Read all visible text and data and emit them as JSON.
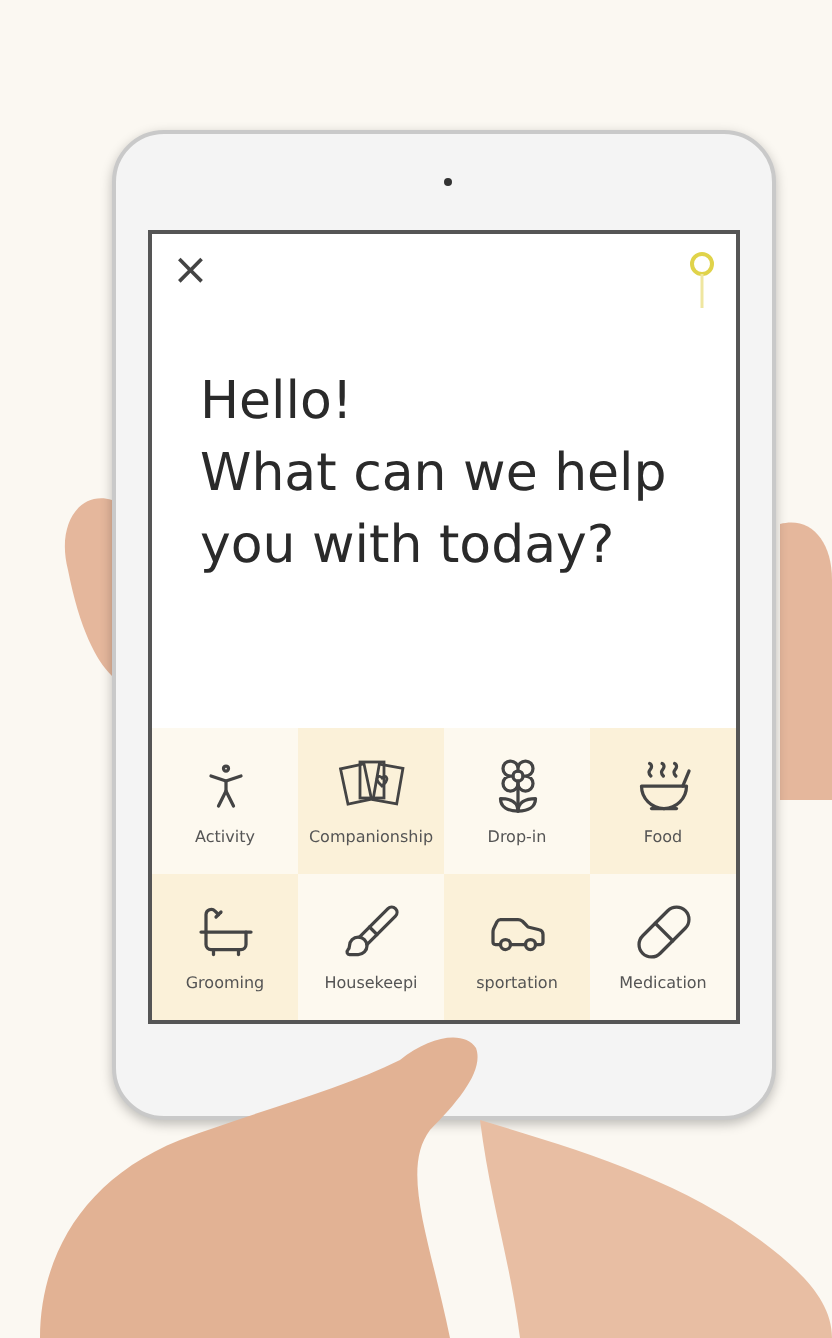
{
  "screen": {
    "close_icon": "×",
    "greeting": "Hello!",
    "question": "What can we help you with today?"
  },
  "services": [
    {
      "label": "Activity"
    },
    {
      "label": "Companionship"
    },
    {
      "label": "Drop-in"
    },
    {
      "label": "Food"
    },
    {
      "label": "Grooming"
    },
    {
      "label": "Housekeepi"
    },
    {
      "label": "sportation"
    },
    {
      "label": "Medication"
    }
  ]
}
